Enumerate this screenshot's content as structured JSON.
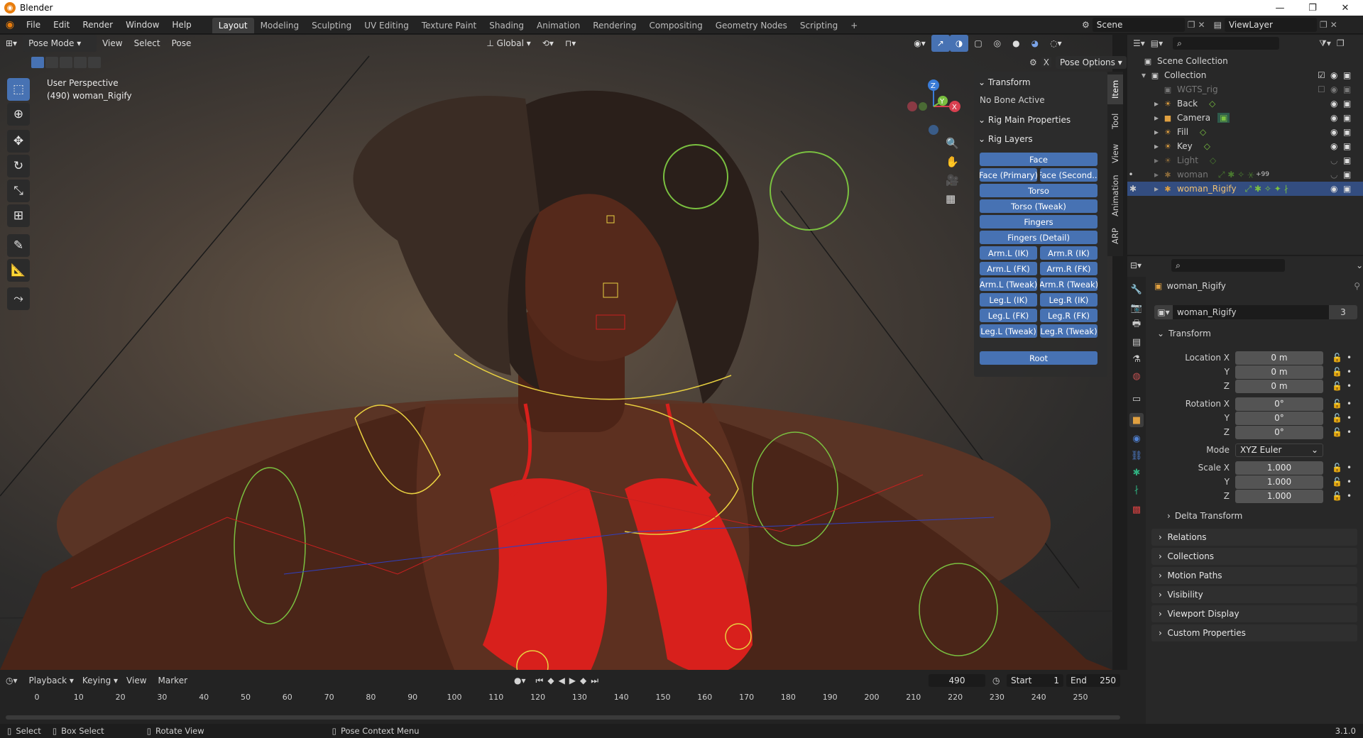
{
  "window": {
    "title": "Blender"
  },
  "menu": [
    "File",
    "Edit",
    "Render",
    "Window",
    "Help"
  ],
  "workspaces": [
    "Layout",
    "Modeling",
    "Sculpting",
    "UV Editing",
    "Texture Paint",
    "Shading",
    "Animation",
    "Rendering",
    "Compositing",
    "Geometry Nodes",
    "Scripting"
  ],
  "workspace_add": "+",
  "scene": {
    "name": "Scene",
    "view_layer": "ViewLayer"
  },
  "viewport": {
    "mode": "Pose Mode",
    "menus": [
      "View",
      "Select",
      "Pose"
    ],
    "orientation": "Global",
    "pose_options": "Pose Options",
    "overlay_line1": "User Perspective",
    "overlay_line2": "(490) woman_Rigify",
    "axes": {
      "x": "X",
      "y": "Y",
      "z": "Z"
    }
  },
  "npanel": {
    "transform_title": "Transform",
    "no_bone": "No Bone Active",
    "rig_main": "Rig Main Properties",
    "rig_layers": "Rig Layers",
    "buttons_full": [
      "Face",
      "Torso",
      "Torso (Tweak)",
      "Fingers",
      "Fingers (Detail)",
      "Root"
    ],
    "buttons_pairs": [
      [
        "Face (Primary)",
        "Face (Second..."
      ],
      [
        "Arm.L (IK)",
        "Arm.R (IK)"
      ],
      [
        "Arm.L (FK)",
        "Arm.R (FK)"
      ],
      [
        "Arm.L (Tweak)",
        "Arm.R (Tweak)"
      ],
      [
        "Leg.L (IK)",
        "Leg.R (IK)"
      ],
      [
        "Leg.L (FK)",
        "Leg.R (FK)"
      ],
      [
        "Leg.L (Tweak)",
        "Leg.R (Tweak)"
      ]
    ],
    "tabs": [
      "Item",
      "Tool",
      "View",
      "Animation",
      "ARP"
    ]
  },
  "outliner": {
    "rows": [
      {
        "label": "Scene Collection",
        "indent": 0,
        "icon": "collection-icon"
      },
      {
        "label": "Collection",
        "indent": 1,
        "icon": "collection-icon"
      },
      {
        "label": "WGTS_rig",
        "indent": 2,
        "icon": "collection-icon",
        "dim": true
      },
      {
        "label": "Back",
        "indent": 2,
        "icon": "light-icon"
      },
      {
        "label": "Camera",
        "indent": 2,
        "icon": "camera-icon"
      },
      {
        "label": "Fill",
        "indent": 2,
        "icon": "light-icon"
      },
      {
        "label": "Key",
        "indent": 2,
        "icon": "light-icon"
      },
      {
        "label": "Light",
        "indent": 2,
        "icon": "light-icon",
        "dim": true
      },
      {
        "label": "woman",
        "indent": 2,
        "icon": "armature-icon",
        "dim": true
      },
      {
        "label": "woman_Rigify",
        "indent": 2,
        "icon": "armature-icon",
        "selected": true
      }
    ],
    "badge": "+99"
  },
  "properties": {
    "object_name": "woman_Rigify",
    "datablock_name": "woman_Rigify",
    "users": "3",
    "transform": "Transform",
    "location": [
      {
        "label": "Location X",
        "value": "0 m"
      },
      {
        "label": "Y",
        "value": "0 m"
      },
      {
        "label": "Z",
        "value": "0 m"
      }
    ],
    "rotation": [
      {
        "label": "Rotation X",
        "value": "0°"
      },
      {
        "label": "Y",
        "value": "0°"
      },
      {
        "label": "Z",
        "value": "0°"
      }
    ],
    "mode_label": "Mode",
    "mode_value": "XYZ Euler",
    "scale": [
      {
        "label": "Scale X",
        "value": "1.000"
      },
      {
        "label": "Y",
        "value": "1.000"
      },
      {
        "label": "Z",
        "value": "1.000"
      }
    ],
    "delta": "Delta Transform",
    "sections": [
      "Relations",
      "Collections",
      "Motion Paths",
      "Visibility",
      "Viewport Display",
      "Custom Properties"
    ]
  },
  "timeline": {
    "menus": [
      "Playback",
      "Keying",
      "View",
      "Marker"
    ],
    "current_frame": "490",
    "start_label": "Start",
    "start": "1",
    "end_label": "End",
    "end": "250",
    "ticks": [
      "0",
      "10",
      "20",
      "30",
      "40",
      "50",
      "60",
      "70",
      "80",
      "90",
      "100",
      "110",
      "120",
      "130",
      "140",
      "150",
      "160",
      "170",
      "180",
      "190",
      "200",
      "210",
      "220",
      "230",
      "240",
      "250"
    ]
  },
  "statusbar": {
    "select": "Select",
    "box_select": "Box Select",
    "rotate": "Rotate View",
    "context": "Pose Context Menu",
    "version": "3.1.0"
  },
  "colors": {
    "accent": "#4772b3",
    "selected_row": "#334d80",
    "bikini": "#d8201c",
    "bone_yellow": "#e8d040",
    "bone_green": "#7ac040"
  }
}
